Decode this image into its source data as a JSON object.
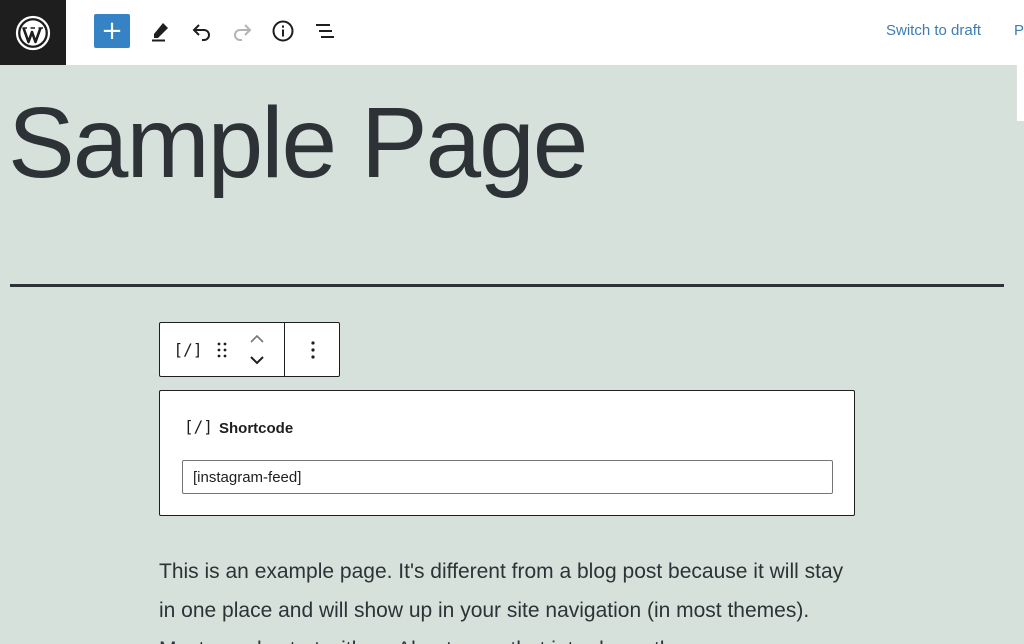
{
  "topbar": {
    "add_label": "+",
    "switch_draft": "Switch to draft",
    "preview_cut": "P"
  },
  "icons": {
    "logo": "wordpress-logo",
    "add": "plus-icon",
    "tools": "pencil-icon",
    "undo": "undo-icon",
    "redo": "redo-icon",
    "details": "info-icon",
    "outline": "list-view-icon",
    "shortcode": "shortcode-icon",
    "drag": "drag-handle-icon",
    "move": "chevron-up-down-icon",
    "more": "vertical-ellipsis-icon"
  },
  "colors": {
    "canvas": "#d6e1db",
    "accent": "#3582c4",
    "link": "#3b7cb5",
    "logo_bg": "#1e1e1e"
  },
  "content": {
    "title": "Sample Page",
    "paragraph": "This is an example page. It's different from a blog post because it will stay in one place and will show up in your site navigation (in most themes). Most people start with an About page that introduces them"
  },
  "block_toolbar": {
    "shortcode_glyph": "[/]"
  },
  "shortcode_block": {
    "icon_glyph": "[/]",
    "label": "Shortcode",
    "value": "[instagram-feed]"
  }
}
